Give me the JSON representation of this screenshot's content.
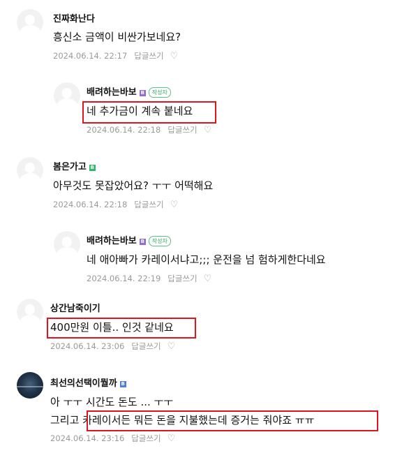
{
  "comments": [
    {
      "nickname": "진짜화난다",
      "lines": [
        "흥신소 금액이 비싼가보네요?"
      ],
      "date": "2024.06.14. 22:17",
      "reply": "답글쓰기",
      "heart": "♡"
    },
    {
      "nickname": "배려하는바보",
      "level": "B",
      "badge": "작성자",
      "lines": [
        "네 추가금이 계속 붙네요"
      ],
      "date": "2024.06.14. 22:18",
      "reply": "답글쓰기",
      "heart": "♡"
    },
    {
      "nickname": "봄은가고",
      "level": "B",
      "lines": [
        "아무것도 못잡았어요? ㅜㅜ 어떡해요"
      ],
      "date": "2024.06.14. 22:18",
      "reply": "답글쓰기",
      "heart": "♡"
    },
    {
      "nickname": "배려하는바보",
      "level": "B",
      "badge": "작성자",
      "lines": [
        "네 애아빠가 카레이서냐고;;; 운전을 넘 험하게한다네요"
      ],
      "date": "2024.06.14. 22:19",
      "reply": "답글쓰기",
      "heart": "♡"
    },
    {
      "nickname": "상간남죽이기",
      "lines": [
        "400만원 이틀.. 인것 같네요"
      ],
      "date": "2024.06.14. 23:06",
      "reply": "답글쓰기",
      "heart": "♡"
    },
    {
      "nickname": "최선의선택이뭘까",
      "level": "B",
      "lines": [
        "아 ㅜㅜ 시간도 돈도 ... ㅜㅜ",
        "그리고 카레이서든 뭐든 돈을 지불했는데 증거는 줘야죠 ㅠㅠ"
      ],
      "date": "2024.06.14. 23:16",
      "reply": "답글쓰기",
      "heart": "♡"
    }
  ],
  "colors": {
    "highlight": "#e0141c",
    "meta": "#9a9a9a",
    "author_badge": "#2fa862"
  }
}
